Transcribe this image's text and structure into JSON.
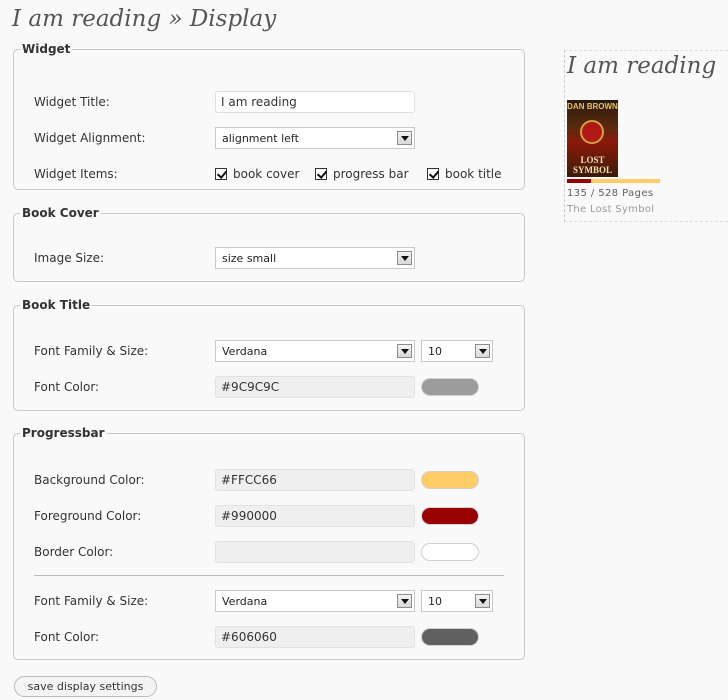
{
  "page": {
    "title": "I am reading » Display"
  },
  "widget": {
    "legend": "Widget",
    "title_label": "Widget Title:",
    "title_value": "I am reading",
    "alignment_label": "Widget Alignment:",
    "alignment_value": "alignment left",
    "items_label": "Widget Items:",
    "items": [
      {
        "label": "book cover",
        "checked": true
      },
      {
        "label": "progress bar",
        "checked": true
      },
      {
        "label": "book title",
        "checked": true
      }
    ]
  },
  "book_cover": {
    "legend": "Book Cover",
    "size_label": "Image Size:",
    "size_value": "size small"
  },
  "book_title": {
    "legend": "Book Title",
    "font_label": "Font Family & Size:",
    "font_family": "Verdana",
    "font_size": "10",
    "color_label": "Font Color:",
    "color_value": "#9C9C9C",
    "swatch_color": "#9C9C9C"
  },
  "progressbar": {
    "legend": "Progressbar",
    "bg_label": "Background Color:",
    "bg_value": "#FFCC66",
    "bg_swatch": "#FFCC66",
    "fg_label": "Foreground Color:",
    "fg_value": "#990000",
    "fg_swatch": "#990000",
    "border_label": "Border Color:",
    "border_value": "",
    "border_swatch": "#FFFFFF",
    "font_label": "Font Family & Size:",
    "font_family": "Verdana",
    "font_size": "10",
    "color_label": "Font Color:",
    "color_value": "#606060",
    "swatch_color": "#606060"
  },
  "actions": {
    "save_label": "save display settings"
  },
  "preview": {
    "title": "I am reading",
    "cover_author": "DAN BROWN",
    "cover_title": "LOST SYMBOL",
    "pages_text": "135 / 528 Pages",
    "progress_fraction": 0.2557,
    "book_title": "The Lost Symbol"
  }
}
